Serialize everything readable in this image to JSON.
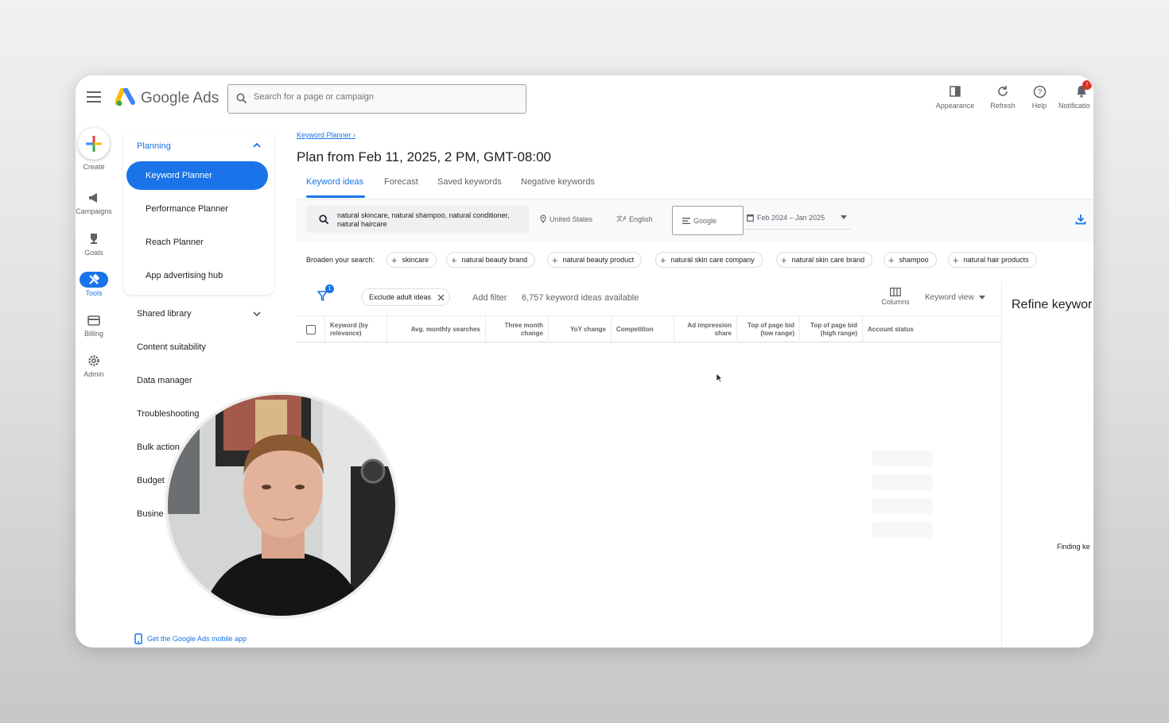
{
  "app": {
    "name": "Google Ads"
  },
  "search": {
    "placeholder": "Search for a page or campaign"
  },
  "top_actions": [
    {
      "label": "Appearance",
      "icon": "appearance-icon"
    },
    {
      "label": "Refresh",
      "icon": "refresh-icon"
    },
    {
      "label": "Help",
      "icon": "help-icon"
    },
    {
      "label": "Notificatio",
      "icon": "bell-icon",
      "badge": "!"
    }
  ],
  "rail": {
    "create": "Create",
    "campaigns": "Campaigns",
    "goals": "Goals",
    "tools": "Tools",
    "billing": "Billing",
    "admin": "Admin"
  },
  "sidenav": {
    "planning": "Planning",
    "planning_items": [
      "Keyword Planner",
      "Performance Planner",
      "Reach Planner",
      "App advertising hub"
    ],
    "items": [
      "Shared library",
      "Content suitability",
      "Data manager",
      "Troubleshooting",
      "Bulk action",
      "Budget",
      "Busine"
    ],
    "mobile_link": "Get the Google Ads mobile app"
  },
  "breadcrumb": "Keyword Planner",
  "plan_title": "Plan from Feb 11, 2025, 2 PM, GMT-08:00",
  "tabs": [
    "Keyword ideas",
    "Forecast",
    "Saved keywords",
    "Negative keywords"
  ],
  "filters": {
    "keywords": "natural skincare, natural shampoo, natural conditioner, natural haircare",
    "location": "United States",
    "language": "English",
    "network": "Google",
    "date_range": "Feb 2024 – Jan 2025"
  },
  "broaden": {
    "label": "Broaden your search:",
    "chips": [
      "skincare",
      "natural beauty brand",
      "natural beauty product",
      "natural skin care company",
      "natural skin care brand",
      "shampoo",
      "natural hair products"
    ]
  },
  "toolbar": {
    "filter_count": "1",
    "exclude_chip": "Exclude adult ideas",
    "add_filter": "Add filter",
    "ideas_count": "6,757 keyword ideas available",
    "columns": "Columns",
    "keyword_view": "Keyword view"
  },
  "table": {
    "headers": [
      "Keyword (by relevance)",
      "Avg. monthly searches",
      "Three month change",
      "YoY change",
      "Competition",
      "Ad impression share",
      "Top of page bid (low range)",
      "Top of page bid (high range)",
      "Account status"
    ]
  },
  "refine": {
    "title": "Refine keywor",
    "finding": "Finding ke"
  },
  "colors": {
    "accent": "#1a73e8",
    "badge": "#d93025"
  }
}
